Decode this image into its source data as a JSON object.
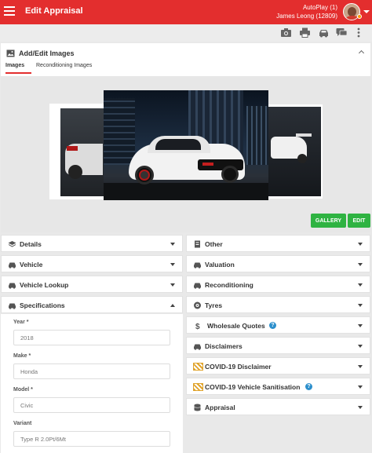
{
  "header": {
    "title": "Edit Appraisal",
    "account_line1": "AutoPlay (1)",
    "account_line2": "James Leong (12809)"
  },
  "toolbar": {
    "icons": [
      "camera-icon",
      "printer-icon",
      "car-icon",
      "chat-icon",
      "more-icon"
    ]
  },
  "images_panel": {
    "title": "Add/Edit Images",
    "tabs": [
      "Images",
      "Reconditioning Images"
    ],
    "active_tab": "Images",
    "gallery_label": "GALLERY",
    "edit_label": "EDIT"
  },
  "left_sections": [
    {
      "label": "Details",
      "icon": "layers-icon"
    },
    {
      "label": "Vehicle",
      "icon": "car-icon"
    },
    {
      "label": "Vehicle Lookup",
      "icon": "car-icon"
    },
    {
      "label": "Specifications",
      "icon": "car-icon",
      "expanded": true
    }
  ],
  "right_sections": [
    {
      "label": "Other",
      "icon": "document-icon"
    },
    {
      "label": "Valuation",
      "icon": "car-icon"
    },
    {
      "label": "Reconditioning",
      "icon": "car-icon"
    },
    {
      "label": "Tyres",
      "icon": "tyre-icon"
    },
    {
      "label": "Wholesale Quotes",
      "icon": "dollar-icon",
      "help": true
    },
    {
      "label": "Disclaimers",
      "icon": "car-icon"
    },
    {
      "label": "COVID-19 Disclaimer",
      "icon": "hazard-icon"
    },
    {
      "label": "COVID-19 Vehicle Sanitisation",
      "icon": "hazard-icon",
      "help": true
    },
    {
      "label": "Appraisal",
      "icon": "database-icon"
    }
  ],
  "specifications": {
    "year_label": "Year *",
    "year_value": "2018",
    "make_label": "Make *",
    "make_value": "Honda",
    "model_label": "Model *",
    "model_value": "Civic",
    "variant_label": "Variant",
    "variant_value": "Type R 2.0Pt/6Mt"
  },
  "colors": {
    "brand_red": "#e32e2e",
    "gallery_green": "#2fb342",
    "help_blue": "#2c8fcc",
    "hazard_yellow": "#e0a32b"
  }
}
